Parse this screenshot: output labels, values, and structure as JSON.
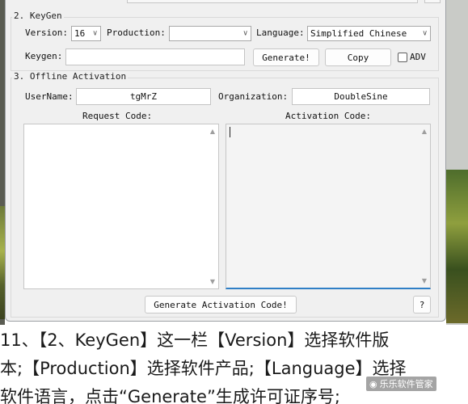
{
  "keygen": {
    "title": "2. KeyGen",
    "version_label": "Version:",
    "version_value": "16",
    "production_label": "Production:",
    "production_value": "",
    "language_label": "Language:",
    "language_value": "Simplified Chinese",
    "keygen_label": "Keygen:",
    "keygen_value": "",
    "generate_label": "Generate!",
    "copy_label": "Copy",
    "adv_label": "ADV"
  },
  "activation": {
    "title": "3. Offline Activation",
    "username_label": "UserName:",
    "username_value": "tgMrZ",
    "organization_label": "Organization:",
    "organization_value": "DoubleSine",
    "request_code_label": "Request Code:",
    "activation_code_label": "Activation Code:",
    "generate_activation_label": "Generate Activation Code!",
    "help_label": "?"
  },
  "article": {
    "line1": "11、【2、KeyGen】这一栏【Version】选择软件版",
    "line2": "本;【Production】选择软件产品;【Language】选择",
    "line3": "软件语言，点击“Generate”生成许可证序号;"
  },
  "watermark": {
    "text": "乐乐软件管家"
  }
}
